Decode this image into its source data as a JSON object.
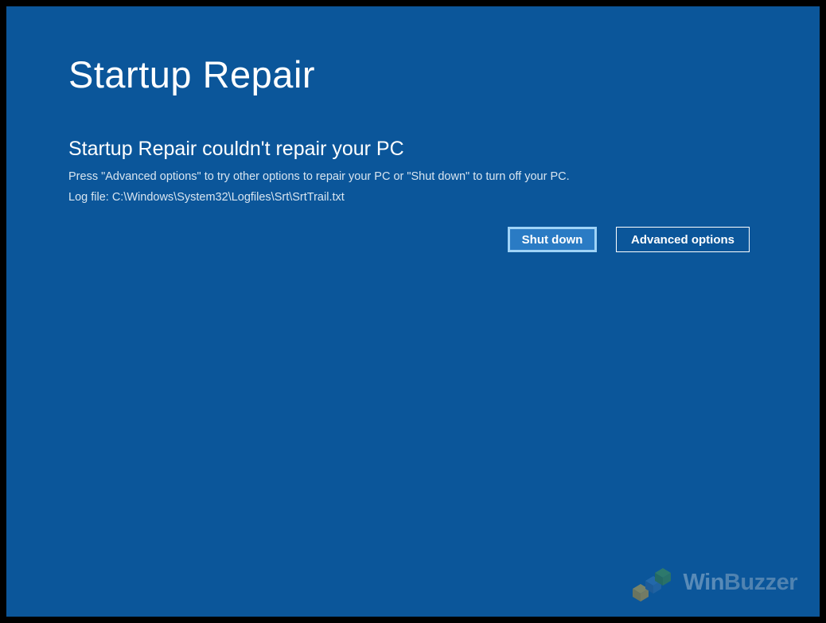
{
  "title": "Startup Repair",
  "subtitle": "Startup Repair couldn't repair your PC",
  "message": "Press \"Advanced options\" to try other options to repair your PC or \"Shut down\" to turn off your PC.",
  "logfile": "Log file: C:\\Windows\\System32\\Logfiles\\Srt\\SrtTrail.txt",
  "buttons": {
    "shutdown": "Shut down",
    "advanced": "Advanced options"
  },
  "watermark": {
    "brand1": "Win",
    "brand2": "Buzzer"
  }
}
